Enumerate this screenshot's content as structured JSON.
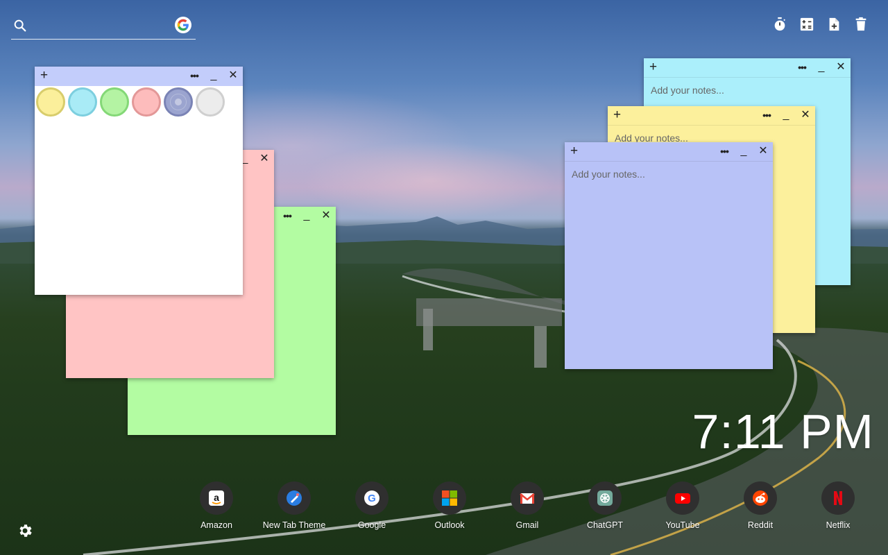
{
  "search": {
    "value": "",
    "placeholder": ""
  },
  "toolbar": [
    {
      "name": "timer-icon"
    },
    {
      "name": "calculator-icon"
    },
    {
      "name": "new-note-icon"
    },
    {
      "name": "trash-icon"
    }
  ],
  "notes": {
    "placeholder": "Add your notes...",
    "white": {
      "color": "#ffffff",
      "palette": [
        "#fbef9b",
        "#a9ebf6",
        "#b4f3a3",
        "#fdbcbc",
        "#9ba4cf",
        "#ececec"
      ],
      "palette_borders": [
        "#d8cd6c",
        "#7dcfdf",
        "#84d877",
        "#e39898",
        "#7a83b5",
        "#cfcfcf"
      ]
    },
    "pink": {
      "color": "#ffc4c4",
      "bar": "#ffc4c4"
    },
    "green": {
      "color": "#b3fca2",
      "bar": "#b3fca2"
    },
    "cyan": {
      "color": "#abeffb",
      "bar": "#abeffb"
    },
    "yellow": {
      "color": "#fcf09c",
      "bar": "#fcf09c"
    },
    "blue": {
      "color": "#b8c2f7",
      "bar": "#b8c2f7"
    },
    "white_bar": "#c3cdfb"
  },
  "clock": {
    "time": "7:11 PM"
  },
  "shortcuts": [
    {
      "label": "Amazon",
      "icon": "amazon-icon"
    },
    {
      "label": "New Tab Theme",
      "icon": "new-tab-theme-icon"
    },
    {
      "label": "Google",
      "icon": "google-icon"
    },
    {
      "label": "Outlook",
      "icon": "outlook-icon"
    },
    {
      "label": "Gmail",
      "icon": "gmail-icon"
    },
    {
      "label": "ChatGPT",
      "icon": "chatgpt-icon"
    },
    {
      "label": "YouTube",
      "icon": "youtube-icon"
    },
    {
      "label": "Reddit",
      "icon": "reddit-icon"
    },
    {
      "label": "Netflix",
      "icon": "netflix-icon"
    }
  ],
  "settings": {
    "icon": "gear-icon"
  }
}
